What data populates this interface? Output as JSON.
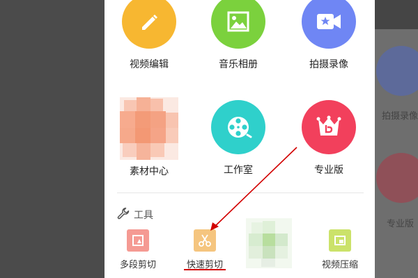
{
  "features": [
    {
      "label": "视频编辑",
      "icon": "pencil-icon",
      "color": "#f7b731"
    },
    {
      "label": "音乐相册",
      "icon": "picture-icon",
      "color": "#7bd13d"
    },
    {
      "label": "拍摄录像",
      "icon": "video-camera-icon",
      "color": "#6f86f4"
    },
    {
      "label": "素材中心",
      "icon": "material-icon",
      "color": "#f7a47f"
    },
    {
      "label": "工作室",
      "icon": "film-reel-icon",
      "color": "#2fd0cb"
    },
    {
      "label": "专业版",
      "icon": "crown-icon",
      "color": "#f2405c"
    }
  ],
  "tools_section": {
    "title": "工具",
    "icon": "wrench-icon"
  },
  "tools": [
    {
      "label": "多段剪切",
      "icon": "multi-cut-icon",
      "color": "#f59a93"
    },
    {
      "label": "快速剪切",
      "icon": "scissors-icon",
      "color": "#f5c57f"
    },
    {
      "label": "",
      "icon": "blurred-tool-icon",
      "color": "#cfe8c4"
    },
    {
      "label": "视频压缩",
      "icon": "compress-icon",
      "color": "#cbe26a"
    }
  ],
  "background_ghost": {
    "labels": [
      "拍摄录像",
      "专业版"
    ]
  },
  "annotation": {
    "arrow_color": "#d20000"
  }
}
